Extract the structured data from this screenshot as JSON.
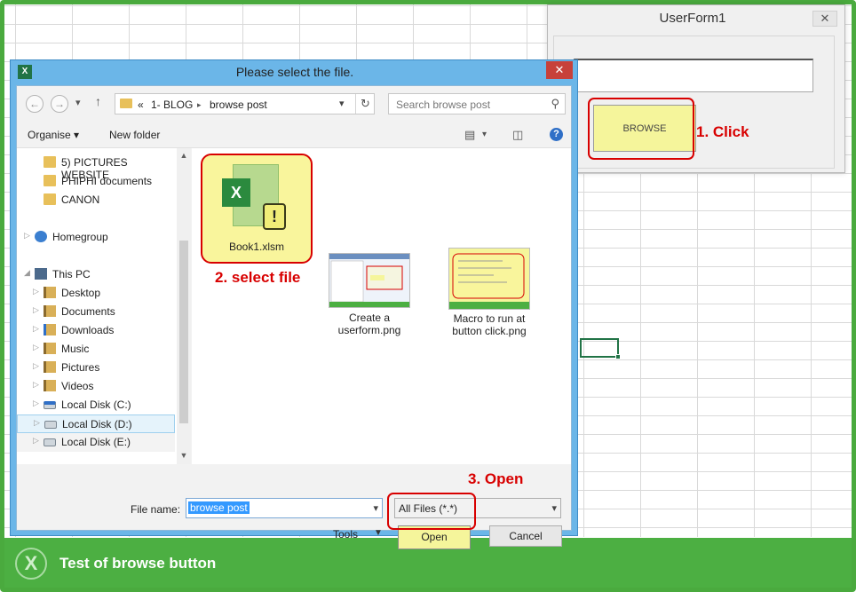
{
  "userform": {
    "title": "UserForm1",
    "close_glyph": "✕",
    "browse_label": "BROWSE"
  },
  "annotations": {
    "click": "1. Click",
    "select_file": "2. select file",
    "open": "3. Open"
  },
  "dialog": {
    "title": "Please select the file.",
    "app_icon": "X",
    "close_glyph": "✕",
    "address": {
      "prefix": "«",
      "crumb1": "1- BLOG",
      "separator": "▸",
      "crumb2": "browse post"
    },
    "search_placeholder": "Search browse post",
    "toolbar": {
      "organise": "Organise ▾",
      "new_folder": "New folder"
    },
    "nav_items": [
      {
        "label": "5) PICTURES WEBSITE",
        "icon": "folder-icon"
      },
      {
        "label": "PHIPHI documents",
        "icon": "folder-icon"
      },
      {
        "label": "CANON",
        "icon": "folder-icon"
      },
      {
        "label": "Homegroup",
        "icon": "homegroup-icon"
      },
      {
        "label": "This PC",
        "icon": "computer-icon"
      },
      {
        "label": "Desktop",
        "icon": "desktop-icon"
      },
      {
        "label": "Documents",
        "icon": "documents-icon"
      },
      {
        "label": "Downloads",
        "icon": "downloads-icon"
      },
      {
        "label": "Music",
        "icon": "music-icon"
      },
      {
        "label": "Pictures",
        "icon": "pictures-icon"
      },
      {
        "label": "Videos",
        "icon": "videos-icon"
      },
      {
        "label": "Local Disk (C:)",
        "icon": "windows-disk-icon"
      },
      {
        "label": "Local Disk (D:)",
        "icon": "disk-icon",
        "selected": true
      },
      {
        "label": "Local Disk (E:)",
        "icon": "disk-icon"
      }
    ],
    "files": [
      {
        "name": "Book1.xlsm",
        "icon": "excel-macro-icon"
      },
      {
        "name_line1": "Create a",
        "name_line2": "userform.png",
        "icon": "image-thumbnail"
      },
      {
        "name_line1": "Macro to run at",
        "name_line2": "button click.png",
        "icon": "image-thumbnail"
      }
    ],
    "filename_label": "File name:",
    "filename_value": "browse post",
    "filter_value": "All Files (*.*)",
    "tools_label": "Tools",
    "open_label": "Open",
    "cancel_label": "Cancel"
  },
  "footer": {
    "logo": "X",
    "title": "Test of browse button"
  },
  "colors": {
    "frame_green": "#4aaa3e",
    "dialog_blue": "#6bb6e8",
    "highlight_yellow": "#f5f59b",
    "annotation_red": "#d80000"
  }
}
